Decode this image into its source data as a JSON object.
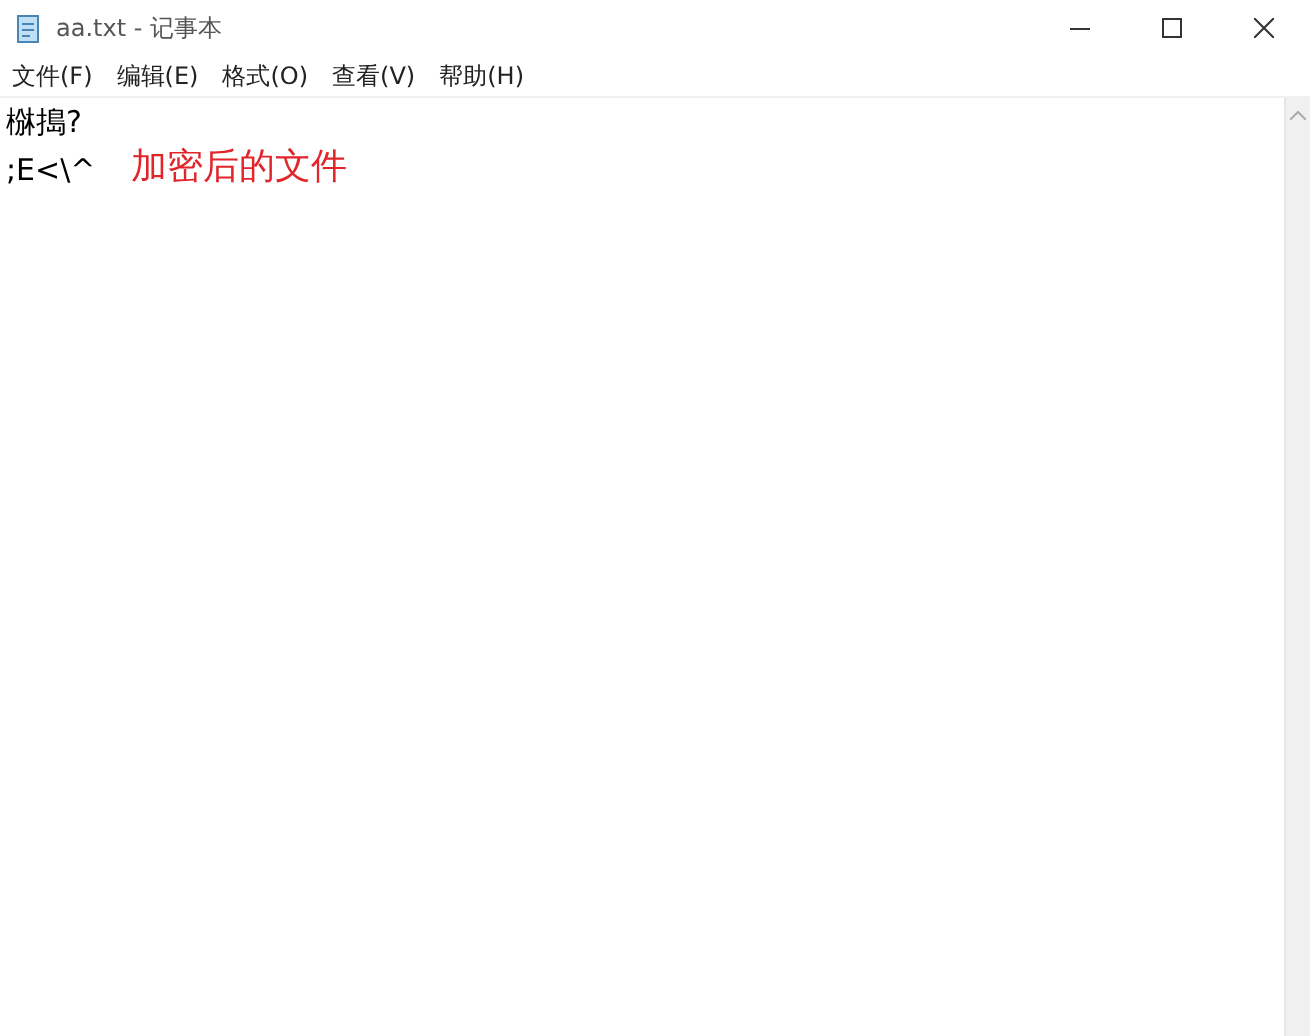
{
  "window": {
    "title": "aa.txt - 记事本"
  },
  "menu": [
    "文件(F)",
    "编辑(E)",
    "格式(O)",
    "查看(V)",
    "帮助(H)"
  ],
  "document": {
    "lines": [
      "椕搗?",
      ";E<\\^"
    ]
  },
  "annotation": {
    "text": "加密后的文件",
    "color": "#e0262b"
  }
}
